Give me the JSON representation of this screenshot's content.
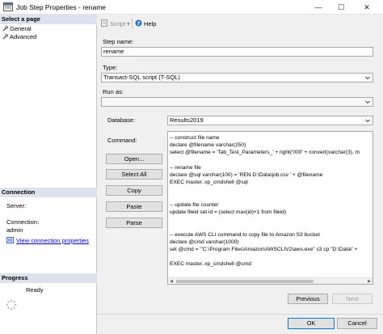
{
  "window": {
    "title": "Job Step Properties - rename",
    "minimize": "—",
    "maximize": "☐",
    "close": "✕"
  },
  "sidebar": {
    "select_page_header": "Select a page",
    "pages": [
      {
        "label": "General"
      },
      {
        "label": "Advanced"
      }
    ],
    "connection_header": "Connection",
    "server_label": "Server:",
    "server_value": "",
    "connection_label": "Connection:",
    "connection_value": "admin",
    "view_connection_link": "View connection properties",
    "progress_header": "Progress",
    "progress_status": "Ready"
  },
  "toolbar": {
    "script_label": "Script",
    "help_label": "Help"
  },
  "form": {
    "step_name_label": "Step name:",
    "step_name_value": "rename",
    "type_label": "Type:",
    "type_value": "Transact-SQL script (T-SQL)",
    "run_as_label": "Run as:",
    "run_as_value": "",
    "database_label": "Database:",
    "database_value": "Results2019",
    "command_label": "Command:"
  },
  "buttons": {
    "open": "Open...",
    "select_all": "Select All",
    "copy": "Copy",
    "paste": "Paste",
    "parse": "Parse",
    "previous": "Previous",
    "next": "Next",
    "ok": "OK",
    "cancel": "Cancel"
  },
  "command_lines": [
    "-- construct file name",
    "declare @filename varchar(250)",
    "select @filename = 'Tab_Test_Parameters_' + right('000' + convert(varchar(3), m",
    "",
    "-- rename file",
    "declare @sql varchar(100) = 'REN D:\\Data\\job.csv ' + @filename",
    "EXEC master..xp_cmdshell @sql",
    "",
    "",
    "-- update file counter",
    "update fileid set id = (select max(id)+1 from fileid)",
    "",
    "",
    "-- execute AWS CLI command to copy file to Amazon S3 bucket",
    "declare @cmd varchar(1000)",
    "set @cmd = '\"C:\\Program Files\\Amazon\\AWSCLIV2\\aws.exe\" s3 cp \"D:\\Data\\' +",
    "",
    "EXEC master..xp_cmdshell @cmd"
  ]
}
